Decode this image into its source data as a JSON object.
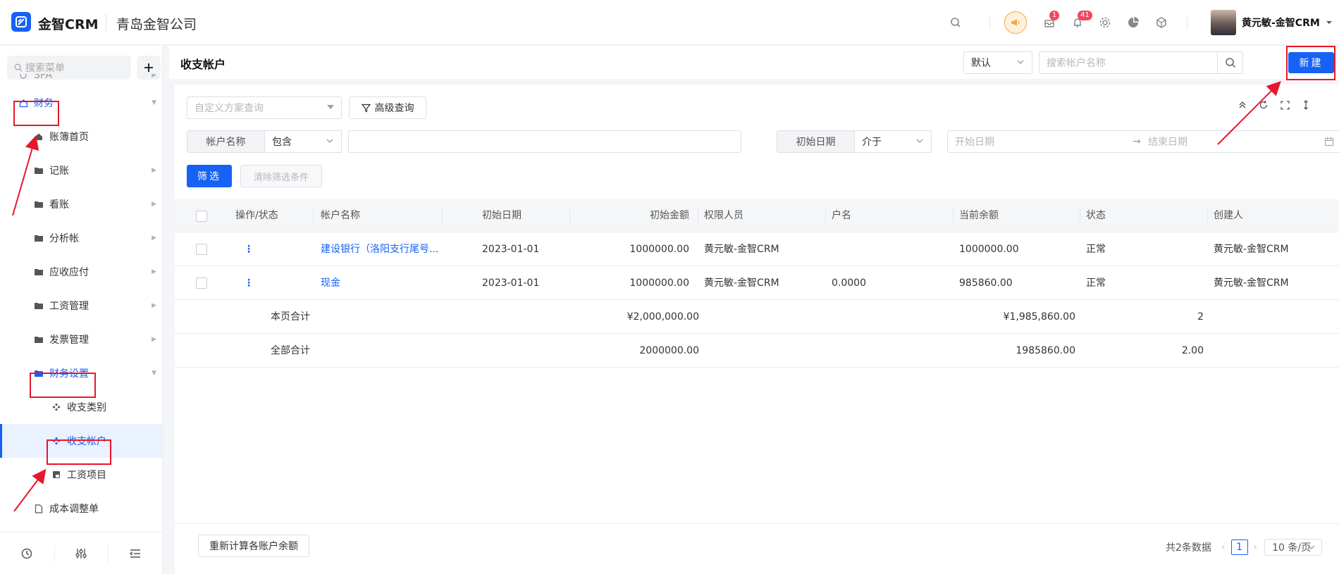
{
  "header": {
    "logo_text": "金智CRM",
    "company": "青岛金智公司",
    "notify_badge_1": "1",
    "notify_badge_2": "41",
    "username": "黄元敏-金智CRM"
  },
  "sidebar": {
    "search_placeholder": "搜索菜单",
    "items": [
      {
        "label": "SPA"
      },
      {
        "label": "财务"
      },
      {
        "label": "账簿首页"
      },
      {
        "label": "记账"
      },
      {
        "label": "看账"
      },
      {
        "label": "分析帐"
      },
      {
        "label": "应收应付"
      },
      {
        "label": "工资管理"
      },
      {
        "label": "发票管理"
      },
      {
        "label": "财务设置"
      },
      {
        "label": "收支类别"
      },
      {
        "label": "收支帐户"
      },
      {
        "label": "工资项目"
      },
      {
        "label": "成本调整单"
      }
    ]
  },
  "page": {
    "title": "收支帐户",
    "view_select": "默认",
    "search_placeholder": "搜索帐户名称",
    "new_button": "新建"
  },
  "filters": {
    "scheme_placeholder": "自定义方案查询",
    "advanced_query": "高级查询",
    "account_name_label": "帐户名称",
    "account_name_op": "包含",
    "start_date_label": "初始日期",
    "start_date_op": "介于",
    "date_from_placeholder": "开始日期",
    "date_to_placeholder": "结束日期",
    "filter_button": "筛选",
    "clear_button": "清除筛选条件"
  },
  "table": {
    "columns": [
      "操作/状态",
      "帐户名称",
      "初始日期",
      "初始金额",
      "权限人员",
      "户名",
      "当前余额",
      "状态",
      "创建人"
    ],
    "rows": [
      {
        "action": "⋮",
        "name": "建设银行（洛阳支行尾号...",
        "date": "2023-01-01",
        "init_amount": "1000000.00",
        "staff": "黄元敏-金智CRM",
        "account_holder": "",
        "balance": "1000000.00",
        "status": "正常",
        "creator": "黄元敏-金智CRM"
      },
      {
        "action": "⋮",
        "name": "现金",
        "date": "2023-01-01",
        "init_amount": "1000000.00",
        "staff": "黄元敏-金智CRM",
        "account_holder": "0.0000",
        "balance": "985860.00",
        "status": "正常",
        "creator": "黄元敏-金智CRM"
      }
    ],
    "page_total": {
      "label": "本页合计",
      "init_amount": "¥2,000,000.00",
      "balance": "¥1,985,860.00",
      "count": "2"
    },
    "all_total": {
      "label": "全部合计",
      "init_amount": "2000000.00",
      "balance": "1985860.00",
      "count": "2.00"
    }
  },
  "footer": {
    "recalc_button": "重新计算各账户余额",
    "total_text": "共2条数据",
    "current_page": "1",
    "page_size": "10 条/页"
  },
  "colors": {
    "primary": "#1662f5",
    "annotation": "#e8162b",
    "badge": "#f5455f",
    "speaker_bg": "#f7a93a"
  }
}
